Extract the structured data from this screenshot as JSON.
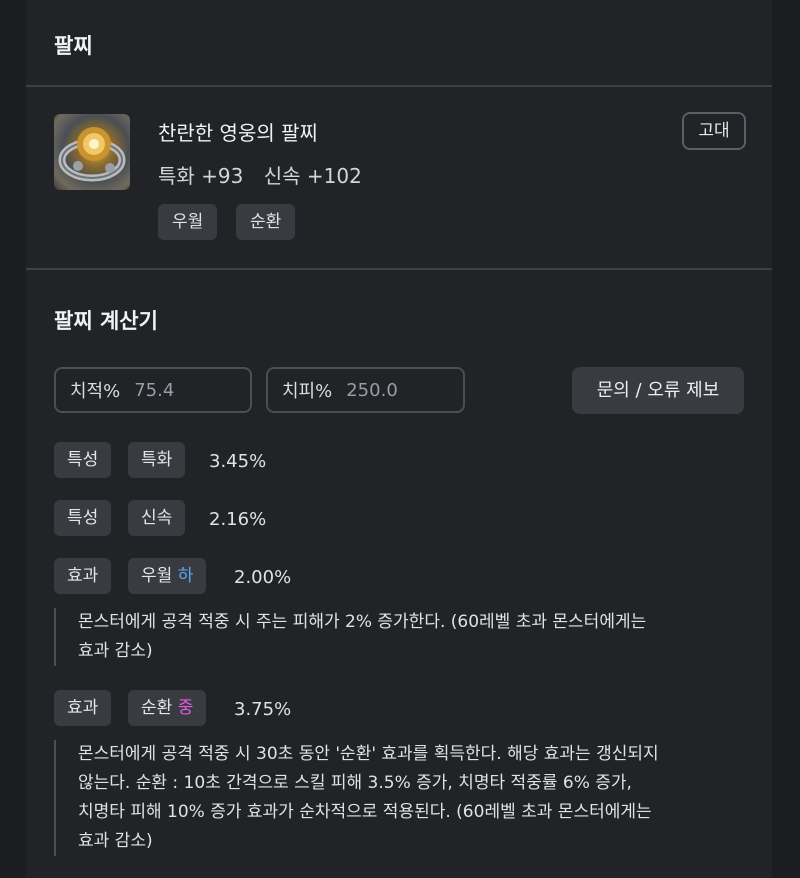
{
  "section_bracelet": {
    "title": "팔찌"
  },
  "item": {
    "name": "찬란한 영웅의 팔찌",
    "grade": "고대",
    "stats": [
      {
        "label": "특화 +93"
      },
      {
        "label": "신속 +102"
      }
    ],
    "tags": [
      "우월",
      "순환"
    ],
    "icon": "bracelet-icon"
  },
  "calculator": {
    "title": "팔찌 계산기",
    "crit_rate": {
      "label": "치적%",
      "placeholder": "75.4"
    },
    "crit_damage": {
      "label": "치피%",
      "placeholder": "250.0"
    },
    "report_button": "문의 / 오류 제보",
    "rows": [
      {
        "type": "특성",
        "name": "특화",
        "value": "3.45%"
      },
      {
        "type": "특성",
        "name": "신속",
        "value": "2.16%"
      },
      {
        "type": "효과",
        "name": "우월",
        "grade": "하",
        "value": "2.00%",
        "desc_lines": [
          "몬스터에게 공격 적중 시 주는 피해가 2% 증가한다. (60레벨 초과 몬스터에게는",
          "효과 감소)"
        ]
      },
      {
        "type": "효과",
        "name": "순환",
        "grade": "중",
        "value": "3.75%",
        "desc_lines": [
          "몬스터에게 공격 적중 시 30초 동안 '순환' 효과를 획득한다. 해당 효과는 갱신되지",
          "않는다. 순환 : 10초 간격으로 스킬 피해 3.5% 증가, 치명타 적중률 6% 증가,",
          "치명타 피해 10% 증가 효과가 순차적으로 적용된다. (60레벨 초과 몬스터에게는",
          "효과 감소)"
        ]
      }
    ]
  },
  "colors": {
    "background": "#1c1d21",
    "panel": "#222327",
    "chip": "#393b41",
    "grade_low": "#56a8f0",
    "grade_mid": "#e25be0"
  }
}
